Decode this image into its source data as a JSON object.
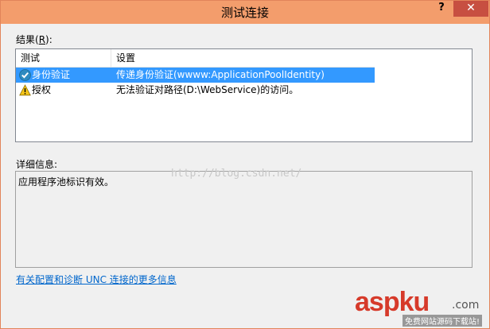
{
  "window": {
    "title": "测试连接",
    "help_label": "?",
    "close_label": "✕"
  },
  "results": {
    "label_pre": "结果(",
    "label_key": "R",
    "label_post": "):",
    "columns": [
      "测试",
      "设置"
    ],
    "rows": [
      {
        "test": "身份验证",
        "setting": "传递身份验证(wwww:ApplicationPoolIdentity)",
        "icon": "success-check-icon",
        "selected": true
      },
      {
        "test": "授权",
        "setting": "无法验证对路径(D:\\WebService)的访问。",
        "icon": "warning-icon",
        "selected": false
      }
    ]
  },
  "details": {
    "label": "详细信息:",
    "text": "应用程序池标识有效。"
  },
  "watermark": "http://blog.csdn.net/",
  "more_link": "有关配置和诊断 UNC 连接的更多信息",
  "logo": {
    "main": "aspku",
    "tail": ".com",
    "sub": "免费网站源码下载站!"
  },
  "colors": {
    "titlebar": "#f39d6c",
    "close_button": "#c74f41",
    "selection": "#3399ff",
    "link": "#0066cc",
    "logo": "#d63a2a"
  }
}
